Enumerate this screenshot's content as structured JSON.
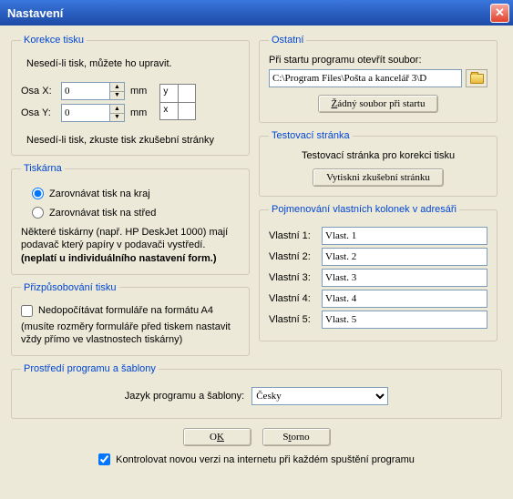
{
  "window": {
    "title": "Nastavení"
  },
  "korekce": {
    "legend": "Korekce tisku",
    "intro": "Nesedí-li tisk, můžete ho upravit.",
    "osax_label": "Osa X:",
    "osax_value": "0",
    "osay_label": "Osa Y:",
    "osay_value": "0",
    "unit": "mm",
    "preview_y": "y",
    "preview_x": "x",
    "note": "Nesedí-li tisk, zkuste tisk zkušební stránky"
  },
  "tiskarna": {
    "legend": "Tiskárna",
    "opt_kraj": "Zarovnávat tisk na kraj",
    "opt_stred": "Zarovnávat tisk na střed",
    "note1": "Některé tiskárny (např. HP DeskJet 1000) mají podavač který papíry v podavači vystředí.",
    "note2": "(neplatí u individuálního nastavení form.)"
  },
  "prizpusob": {
    "legend": "Přizpůsobování tisku",
    "chk_label": "Nedopočítávat formuláře na formátu A4",
    "note": "(musíte rozměry formuláře před tiskem nastavit vždy přímo ve vlastnostech tiskárny)"
  },
  "ostatni": {
    "legend": "Ostatní",
    "open_label": "Při startu programu otevřít soubor:",
    "path": "C:\\Program Files\\Pošta a kancelář 3\\D",
    "btn_none": "Žádný soubor při startu"
  },
  "test": {
    "legend": "Testovací stránka",
    "text": "Testovací stránka pro korekci tisku",
    "btn": "Vytiskni zkušební stránku"
  },
  "kolonky": {
    "legend": "Pojmenování vlastních kolonek v adresáři",
    "l1": "Vlastní 1:",
    "v1": "Vlast. 1",
    "l2": "Vlastní 2:",
    "v2": "Vlast. 2",
    "l3": "Vlastní 3:",
    "v3": "Vlast. 3",
    "l4": "Vlastní 4:",
    "v4": "Vlast. 4",
    "l5": "Vlastní 5:",
    "v5": "Vlast. 5"
  },
  "prostredi": {
    "legend": "Prostředí programu a šablony",
    "label": "Jazyk programu a šablony:",
    "value": "Česky"
  },
  "buttons": {
    "ok_pre": "O",
    "ok_u": "K",
    "cancel_pre": "S",
    "cancel_u": "t",
    "cancel_post": "orno",
    "z_u": "Ž",
    "z_post": "ádný soubor při startu"
  },
  "bottom_chk": "Kontrolovat novou verzi na internetu při každém spuštění programu"
}
